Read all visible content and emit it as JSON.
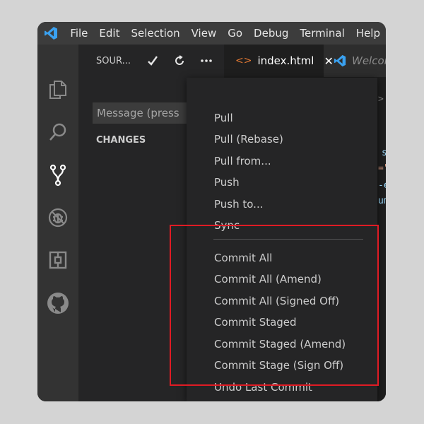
{
  "menubar": {
    "items": [
      "File",
      "Edit",
      "Selection",
      "View",
      "Go",
      "Debug",
      "Terminal",
      "Help"
    ]
  },
  "sidebar": {
    "title": "SOURCE CONTROL",
    "title_display": "SOUR...",
    "message_placeholder": "Message (press Ctrl+Enter to commit)",
    "changes_label": "CHANGES"
  },
  "tabs": [
    {
      "label": "index.html",
      "active": true
    },
    {
      "label": "Welcome",
      "active": false
    }
  ],
  "context_menu": {
    "group1": [
      "Pull",
      "Pull (Rebase)",
      "Pull from...",
      "Push",
      "Push to...",
      "Sync"
    ],
    "group2": [
      "Commit All",
      "Commit All (Amend)",
      "Commit All (Signed Off)",
      "Commit Staged",
      "Commit Staged (Amend)",
      "Commit Stage (Sign Off)",
      "Undo Last Commit"
    ]
  },
  "colors": {
    "highlight": "#e01b24",
    "vscode_blue": "#3aa1f0",
    "html_icon": "#e37933"
  }
}
